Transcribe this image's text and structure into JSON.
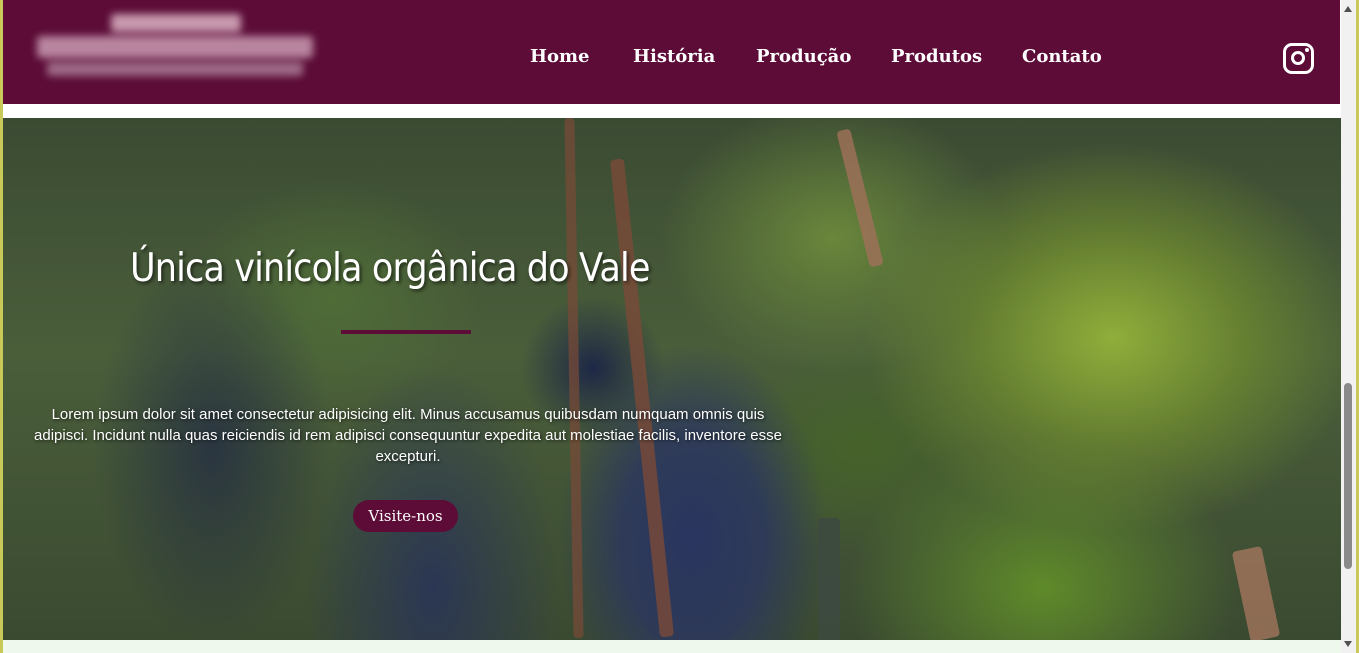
{
  "header": {
    "logo_alt": "",
    "nav": [
      {
        "label": "Home"
      },
      {
        "label": "História"
      },
      {
        "label": "Produção"
      },
      {
        "label": "Produtos"
      },
      {
        "label": "Contato"
      }
    ],
    "social_icon": "instagram-icon"
  },
  "hero": {
    "title": "Única vinícola orgânica do Vale",
    "body": "Lorem ipsum dolor sit amet consectetur adipisicing elit. Minus accusamus quibusdam numquam omnis quis adipisci. Incidunt nulla quas reiciendis id rem adipisci consequuntur expedita aut molestiae facilis, inventore esse excepturi.",
    "cta_label": "Visite-nos"
  },
  "colors": {
    "brand": "#5c0c37",
    "text_on_brand": "#ffffff"
  }
}
